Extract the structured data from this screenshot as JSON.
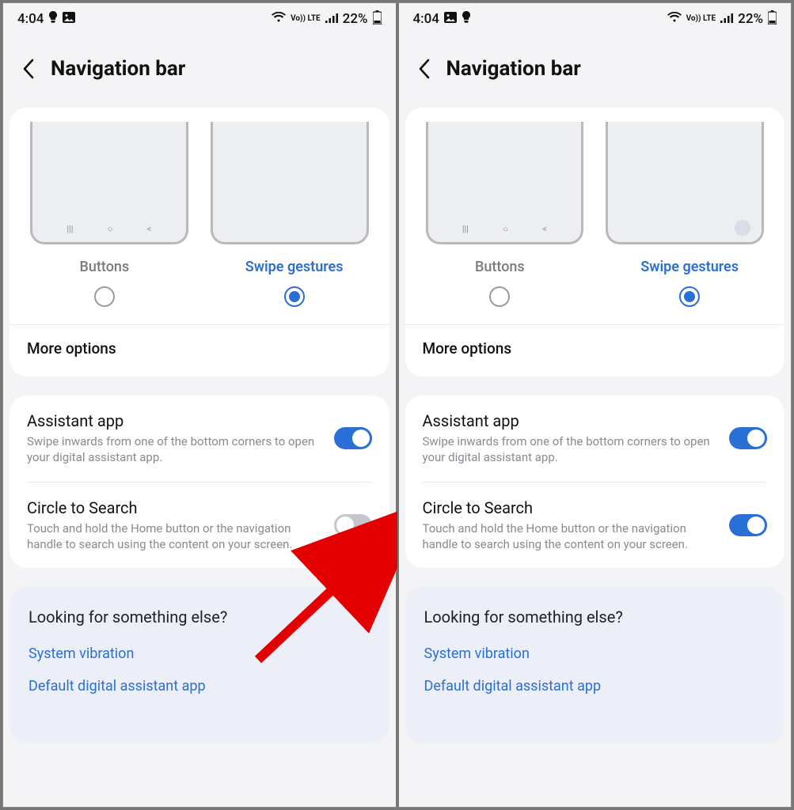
{
  "status": {
    "time": "4:04",
    "volte": "Vo)) LTE",
    "battery_text": "22%"
  },
  "header": {
    "title": "Navigation bar"
  },
  "nav_type": {
    "opt_buttons": "Buttons",
    "opt_swipe": "Swipe gestures",
    "more": "More options"
  },
  "rows": {
    "assistant": {
      "title": "Assistant app",
      "sub": "Swipe inwards from one of the bottom corners to open your digital assistant app."
    },
    "circle": {
      "title": "Circle to Search",
      "sub": "Touch and hold the Home button or the navigation handle to search using the content on your screen."
    }
  },
  "footer": {
    "q": "Looking for something else?",
    "link1": "System vibration",
    "link2": "Default digital assistant app"
  },
  "screens": [
    {
      "circle_on": false
    },
    {
      "circle_on": true
    }
  ]
}
